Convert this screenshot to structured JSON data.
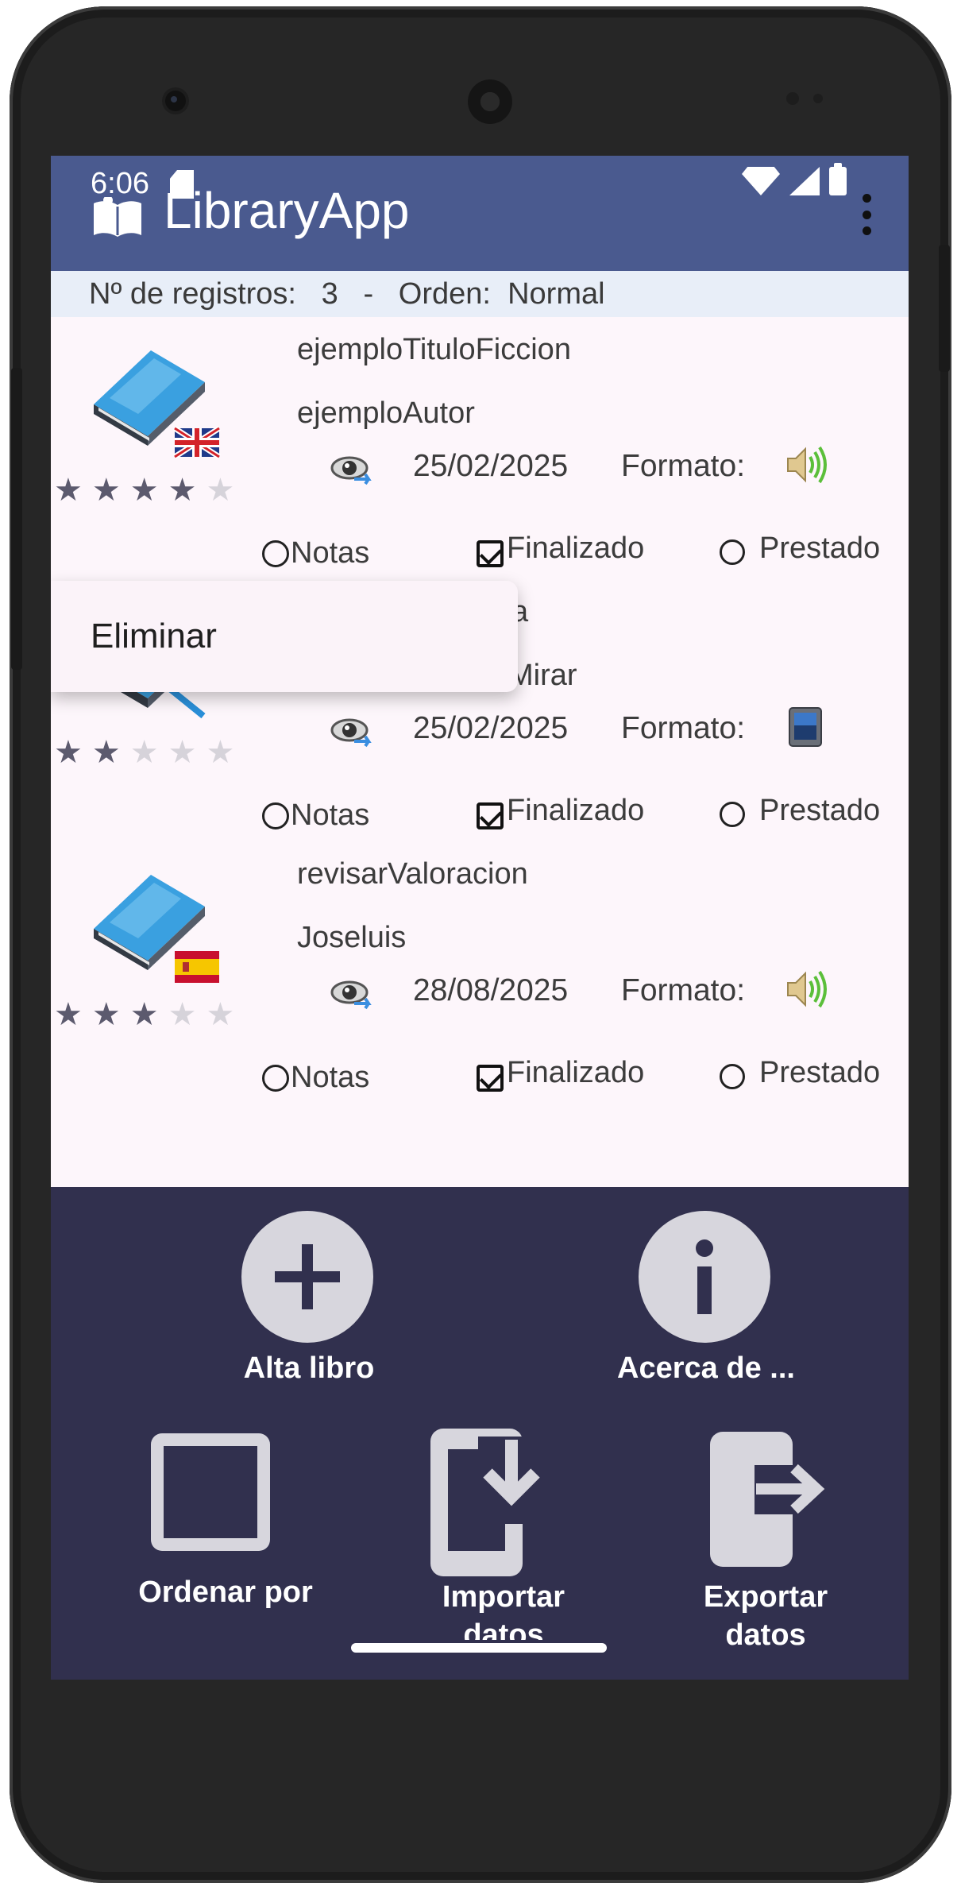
{
  "status_bar": {
    "time": "6:06"
  },
  "app_bar": {
    "title": "LibraryApp"
  },
  "count_bar": {
    "label": "Nº de registros:   ",
    "count": "3",
    "separator": "   -   ",
    "order_label": "Orden:  ",
    "order_value": "Normal"
  },
  "books": [
    {
      "title": "ejemploTituloFiccion",
      "author": "ejemploAutor",
      "date": "25/02/2025",
      "format_label": "Formato:",
      "format_icon": "audio-speaker-icon",
      "flag": "uk-flag",
      "rating": 4,
      "notes_label": "Notas",
      "finished_label": "Finalizado",
      "lent_label": "Prestado"
    },
    {
      "title": "a",
      "author": "Mirar",
      "date": "25/02/2025",
      "format_label": "Formato:",
      "format_icon": "ebook-tablet-icon",
      "rating": 2,
      "notes_label": "Notas",
      "finished_label": "Finalizado",
      "lent_label": "Prestado"
    },
    {
      "title": "revisarValoracion",
      "author": "Joseluis",
      "date": "28/08/2025",
      "format_label": "Formato:",
      "format_icon": "audio-speaker-icon",
      "flag": "spain-flag",
      "rating": 3,
      "notes_label": "Notas",
      "finished_label": "Finalizado",
      "lent_label": "Prestado"
    }
  ],
  "context_menu": {
    "delete_label": "Eliminar"
  },
  "bottom_panel": {
    "add_label": "Alta libro",
    "about_label": "Acerca de ...",
    "order_label": "Ordenar por",
    "import_label": "Importar datos",
    "export_label": "Exportar datos"
  },
  "colors": {
    "app_bar": "#4a5a8f",
    "list_bg": "#fdf6fb",
    "bottom_panel": "#31304e",
    "fab": "#d7d6dd"
  }
}
